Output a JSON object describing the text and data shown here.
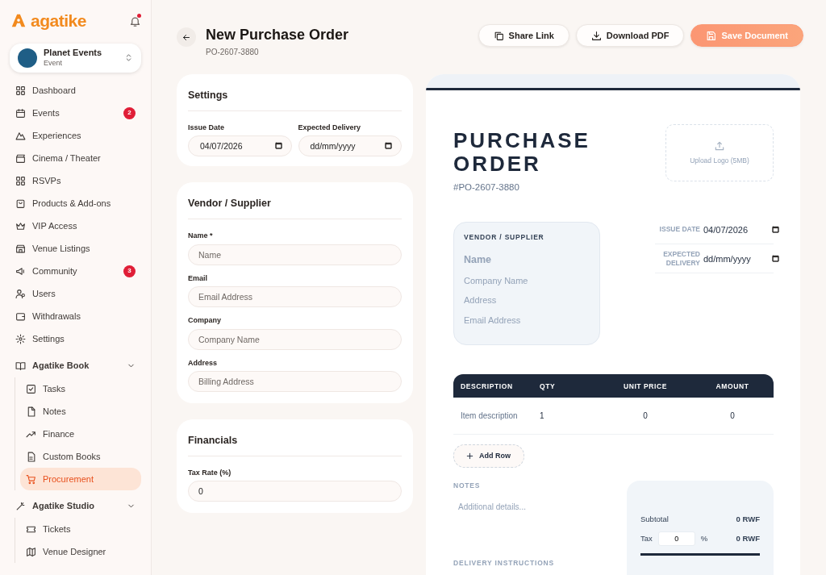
{
  "brand": {
    "name": "agatike"
  },
  "notifications": {
    "unread": true
  },
  "workspace": {
    "name": "Planet Events",
    "type": "Event"
  },
  "nav": [
    {
      "label": "Dashboard",
      "selected": false
    },
    {
      "label": "Events",
      "badge": "2",
      "selected": false
    },
    {
      "label": "Experiences",
      "selected": false
    },
    {
      "label": "Cinema / Theater",
      "selected": false
    },
    {
      "label": "RSVPs",
      "selected": false
    },
    {
      "label": "Products & Add-ons",
      "selected": false
    },
    {
      "label": "VIP Access",
      "selected": false
    },
    {
      "label": "Venue Listings",
      "selected": false
    },
    {
      "label": "Community",
      "badge": "3",
      "selected": false
    },
    {
      "label": "Users",
      "selected": false
    },
    {
      "label": "Withdrawals",
      "selected": false
    },
    {
      "label": "Settings",
      "selected": false
    }
  ],
  "groups": [
    {
      "label": "Agatike Book",
      "expanded": true,
      "children": [
        {
          "label": "Tasks",
          "selected": false
        },
        {
          "label": "Notes",
          "selected": false
        },
        {
          "label": "Finance",
          "selected": false
        },
        {
          "label": "Custom Books",
          "selected": false
        },
        {
          "label": "Procurement",
          "selected": true
        }
      ]
    },
    {
      "label": "Agatike Studio",
      "expanded": true,
      "children": [
        {
          "label": "Tickets",
          "selected": false
        },
        {
          "label": "Venue Designer",
          "selected": false
        }
      ]
    }
  ],
  "header": {
    "title": "New Purchase Order",
    "subtitle": "PO-2607-3880"
  },
  "actions": [
    {
      "label": "Share Link",
      "kind": "outline"
    },
    {
      "label": "Download PDF",
      "kind": "outline"
    },
    {
      "label": "Save Document",
      "kind": "primary"
    }
  ],
  "forms": [
    {
      "title": "Settings",
      "fields": [
        {
          "label": "Issue Date",
          "value": "04/07/2026",
          "kind": "date"
        },
        {
          "label": "Expected Delivery",
          "placeholder": "dd/mm/yyyy",
          "kind": "date"
        }
      ]
    },
    {
      "title": "Vendor / Supplier",
      "fields": [
        {
          "label": "Name *",
          "placeholder": "Name",
          "kind": "text"
        },
        {
          "label": "Email",
          "placeholder": "Email Address",
          "kind": "text"
        },
        {
          "label": "Company",
          "placeholder": "Company Name",
          "kind": "text"
        },
        {
          "label": "Address",
          "placeholder": "Billing Address",
          "kind": "text"
        }
      ]
    },
    {
      "title": "Financials",
      "fields": [
        {
          "label": "Tax Rate (%)",
          "value": "0",
          "kind": "text"
        }
      ]
    }
  ],
  "preview": {
    "title": "PURCHASE ORDER",
    "number": "#PO-2607-3880",
    "upload_logo": "Upload Logo (5MB)",
    "vendor": {
      "heading": "VENDOR / SUPPLIER",
      "name": "Name",
      "lines": [
        "Company Name",
        "Address",
        "Email Address"
      ]
    },
    "dates": [
      {
        "label": "ISSUE DATE",
        "value": "04/07/2026"
      },
      {
        "label": "EXPECTED DELIVERY",
        "placeholder": "dd/mm/yyyy"
      }
    ],
    "table": {
      "columns": [
        "DESCRIPTION",
        "QTY",
        "UNIT PRICE",
        "AMOUNT"
      ],
      "rows": [
        [
          "Item description",
          "1",
          "0",
          "0"
        ]
      ]
    },
    "add_row": "Add Row",
    "notes": {
      "heading": "NOTES",
      "placeholder": "Additional details..."
    },
    "delivery": {
      "heading": "DELIVERY INSTRUCTIONS"
    },
    "summary": {
      "subtotal_label": "Subtotal",
      "subtotal": "0 RWF",
      "tax_label": "Tax",
      "tax_rate": "0",
      "percent": "%",
      "tax": "0 RWF"
    }
  }
}
